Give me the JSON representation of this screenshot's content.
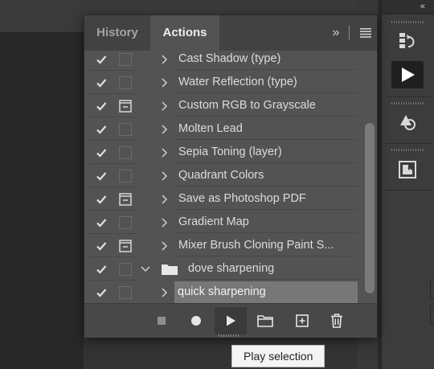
{
  "tabs": {
    "history": "History",
    "actions": "Actions"
  },
  "panel_controls": {
    "collapse": "»"
  },
  "dock": {
    "collapse": "«"
  },
  "actions": [
    {
      "label": "Cast Shadow (type)",
      "checked": true,
      "dialog": false
    },
    {
      "label": "Water Reflection (type)",
      "checked": true,
      "dialog": false
    },
    {
      "label": "Custom RGB to Grayscale",
      "checked": true,
      "dialog": true
    },
    {
      "label": "Molten Lead",
      "checked": true,
      "dialog": false
    },
    {
      "label": "Sepia Toning (layer)",
      "checked": true,
      "dialog": false
    },
    {
      "label": "Quadrant Colors",
      "checked": true,
      "dialog": false
    },
    {
      "label": "Save as Photoshop PDF",
      "checked": true,
      "dialog": true
    },
    {
      "label": "Gradient Map",
      "checked": true,
      "dialog": false
    },
    {
      "label": "Mixer Brush Cloning Paint S...",
      "checked": true,
      "dialog": true
    }
  ],
  "action_set": {
    "label": "dove sharpening",
    "expanded": true
  },
  "set_actions": [
    {
      "label": "quick sharpening",
      "selected": true
    }
  ],
  "footer_buttons": [
    "stop-button",
    "record-button",
    "play-button",
    "new-set-button",
    "new-action-button",
    "delete-button"
  ],
  "tooltip": "Play selection",
  "colors": {
    "panel": "#535353",
    "selection": "#777777",
    "tooltip_bg": "#f4f4f4"
  }
}
